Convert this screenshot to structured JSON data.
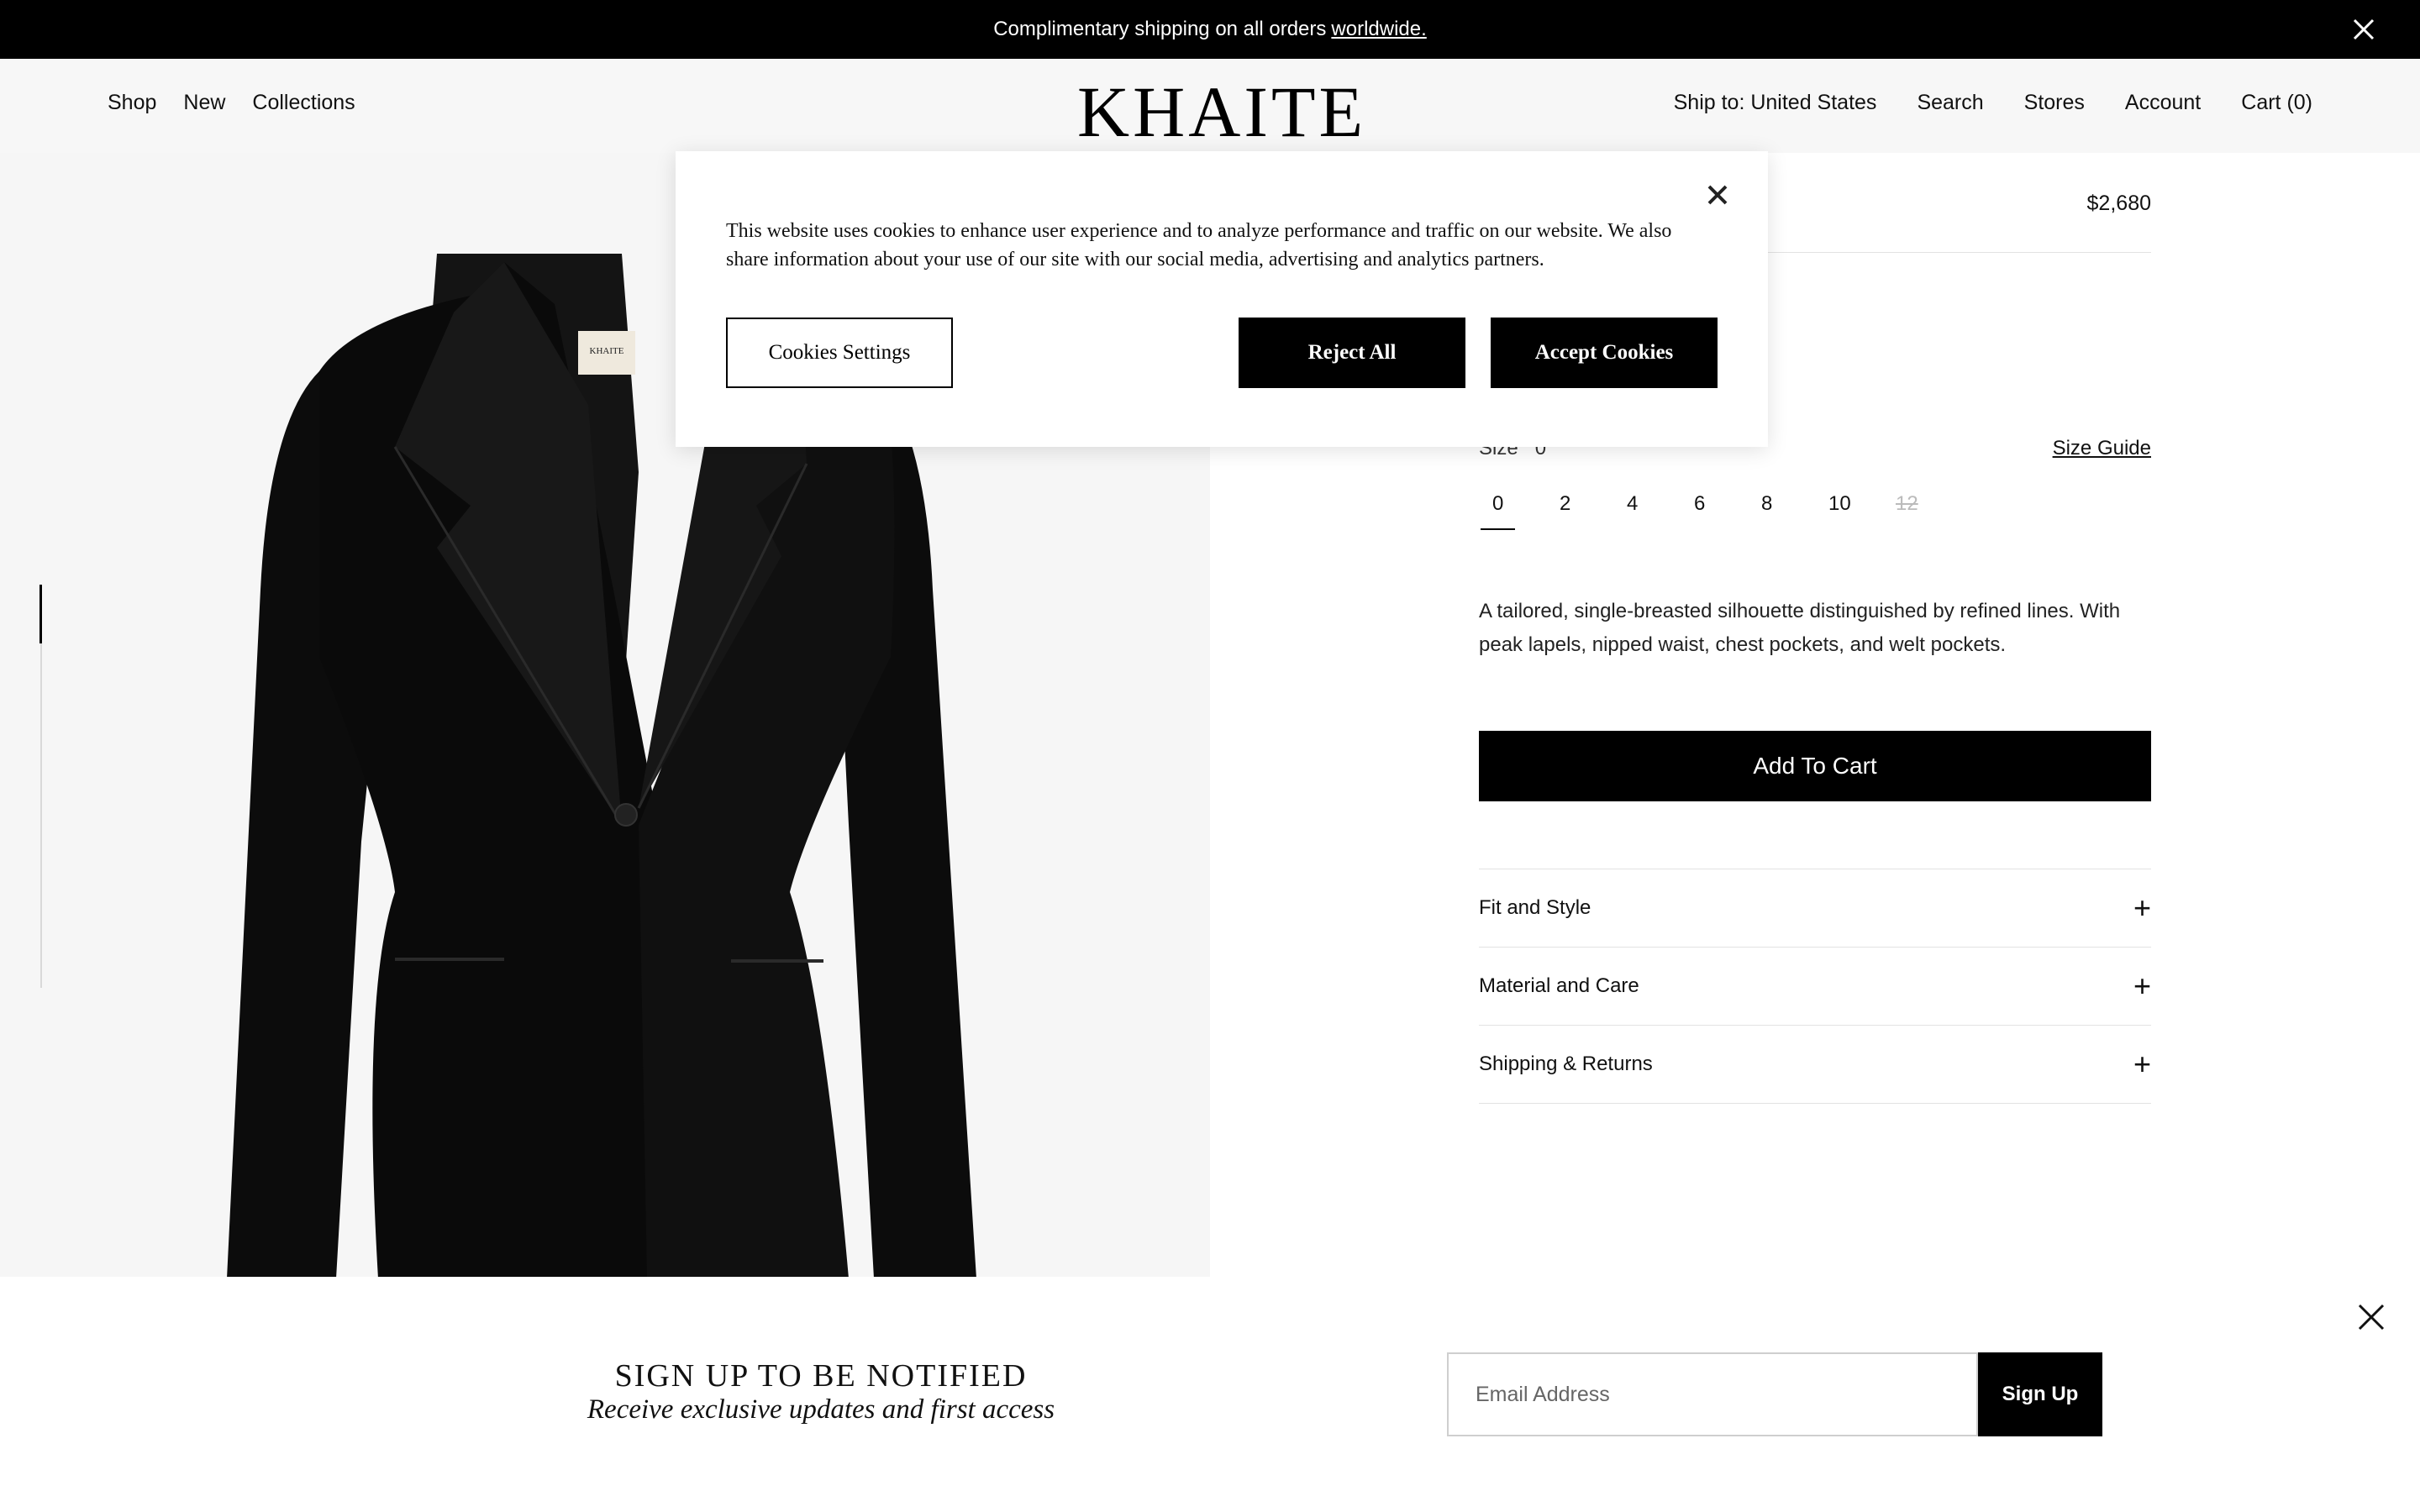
{
  "announcement": {
    "text": "Complimentary shipping on all orders",
    "link": "worldwide."
  },
  "header": {
    "logo": "KHAITE",
    "nav_left": [
      "Shop",
      "New",
      "Collections"
    ],
    "nav_right": [
      "Ship to: United States",
      "Search",
      "Stores",
      "Account",
      "Cart (0)"
    ]
  },
  "product": {
    "price": "$2,680",
    "size_label": "Size",
    "size_selected": "0",
    "size_guide": "Size Guide",
    "sizes": [
      "0",
      "2",
      "4",
      "6",
      "8",
      "10",
      "12"
    ],
    "description": "A tailored, single-breasted silhouette distinguished by refined lines. With peak lapels, nipped waist, chest pockets, and welt pockets.",
    "add_to_cart": "Add To Cart",
    "accordion": [
      "Fit and Style",
      "Material and Care",
      "Shipping & Returns"
    ],
    "label_text": "KHAITE"
  },
  "cookie": {
    "text": "This website uses cookies to enhance user experience and to analyze performance and traffic on our website. We also share information about your use of our site with our social media, advertising and analytics partners.",
    "settings": "Cookies Settings",
    "reject": "Reject All",
    "accept": "Accept Cookies"
  },
  "signup": {
    "title": "SIGN UP TO BE NOTIFIED",
    "subtitle": "Receive exclusive updates and first access",
    "email_placeholder": "Email Address",
    "button": "Sign Up"
  },
  "colors": {
    "black": "#000000",
    "page_bg": "#f6f6f6"
  }
}
